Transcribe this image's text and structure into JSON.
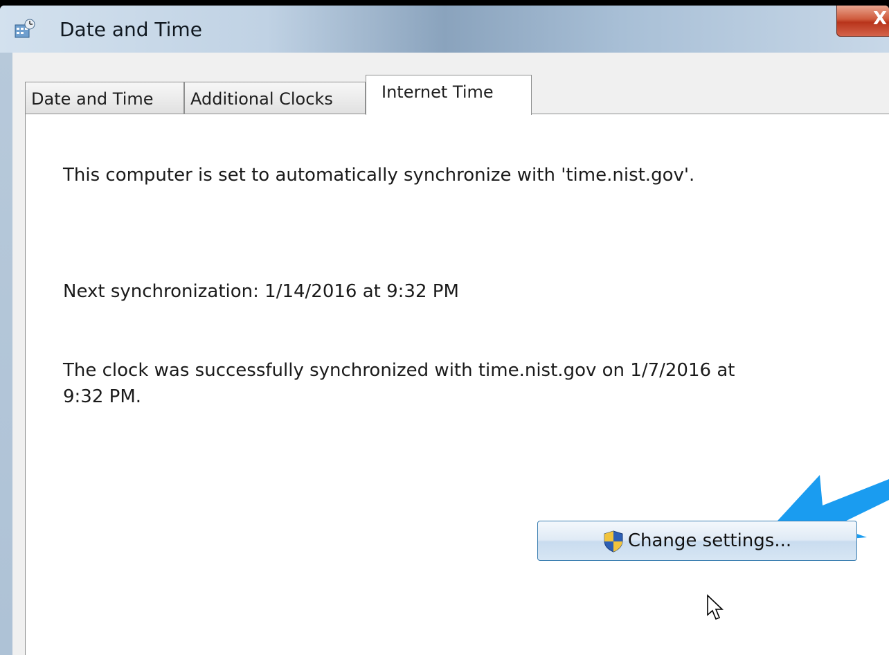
{
  "window": {
    "title": "Date and Time",
    "close_label": "X"
  },
  "tabs": [
    {
      "label": "Date and Time",
      "active": false
    },
    {
      "label": "Additional Clocks",
      "active": false
    },
    {
      "label": "Internet Time",
      "active": true
    }
  ],
  "content": {
    "sync_setting": "This computer is set to automatically synchronize with 'time.nist.gov'.",
    "next_sync": "Next synchronization: 1/14/2016 at 9:32 PM",
    "last_sync_line1": "The clock was successfully synchronized with time.nist.gov on 1/7/2016 at",
    "last_sync_line2": "9:32 PM."
  },
  "actions": {
    "change_settings_label": "Change settings..."
  },
  "icons": {
    "title": "date-time-control-panel-icon",
    "shield": "uac-shield-icon",
    "annotation": "arrow-icon",
    "cursor": "mouse-pointer-icon"
  },
  "colors": {
    "annotation_arrow": "#1a9cf0",
    "button_border": "#3c7fb1",
    "close_button": "#c9462b"
  }
}
